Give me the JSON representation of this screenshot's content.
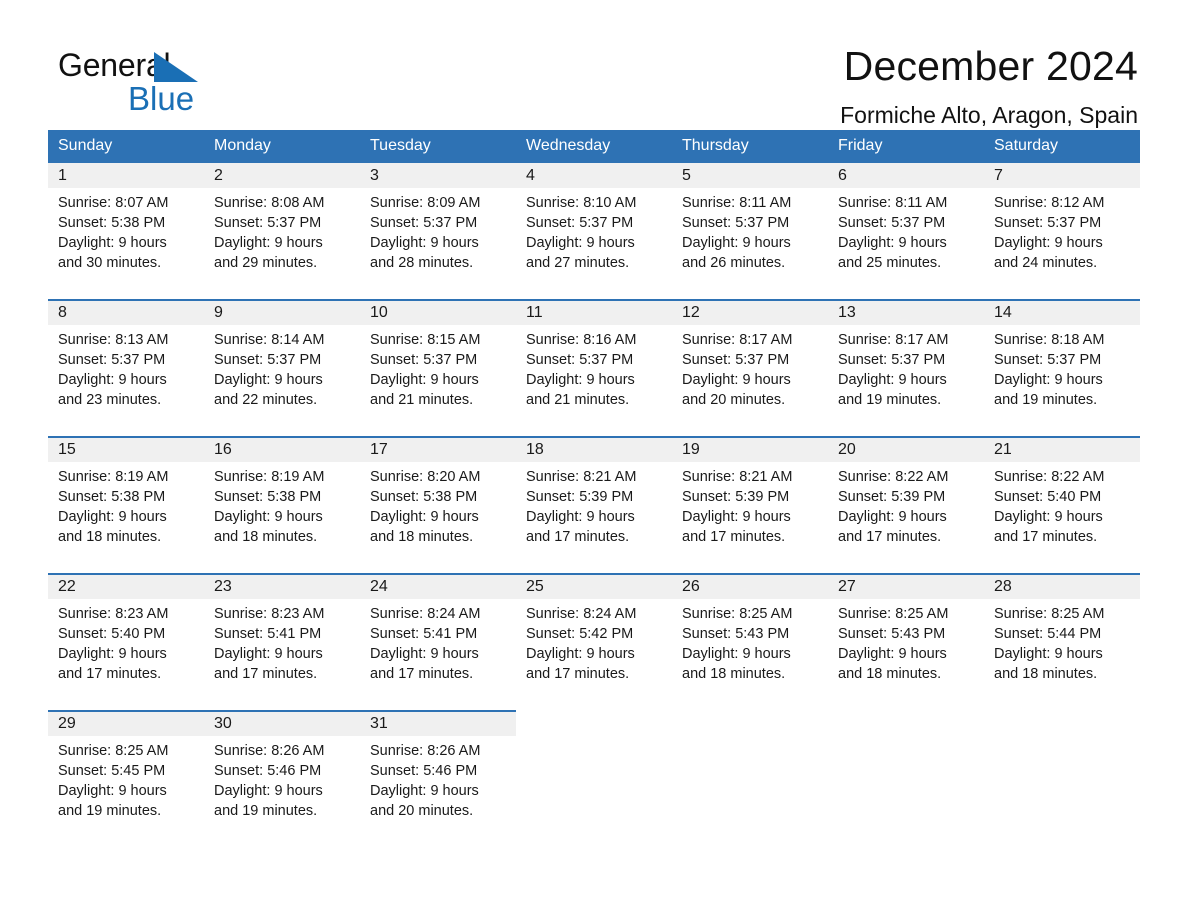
{
  "brand": {
    "name_part1": "General",
    "name_part2": "Blue",
    "triangle_color": "#1a6fb5"
  },
  "header": {
    "title": "December 2024",
    "location": "Formiche Alto, Aragon, Spain"
  },
  "colors": {
    "header_blue": "#2e72b4",
    "daynum_bg": "#f0f0f0",
    "text": "#1a1a1a"
  },
  "calendar": {
    "weekday_headers": [
      "Sunday",
      "Monday",
      "Tuesday",
      "Wednesday",
      "Thursday",
      "Friday",
      "Saturday"
    ],
    "weeks": [
      [
        {
          "day": "1",
          "sunrise": "Sunrise: 8:07 AM",
          "sunset": "Sunset: 5:38 PM",
          "daylight1": "Daylight: 9 hours",
          "daylight2": "and 30 minutes."
        },
        {
          "day": "2",
          "sunrise": "Sunrise: 8:08 AM",
          "sunset": "Sunset: 5:37 PM",
          "daylight1": "Daylight: 9 hours",
          "daylight2": "and 29 minutes."
        },
        {
          "day": "3",
          "sunrise": "Sunrise: 8:09 AM",
          "sunset": "Sunset: 5:37 PM",
          "daylight1": "Daylight: 9 hours",
          "daylight2": "and 28 minutes."
        },
        {
          "day": "4",
          "sunrise": "Sunrise: 8:10 AM",
          "sunset": "Sunset: 5:37 PM",
          "daylight1": "Daylight: 9 hours",
          "daylight2": "and 27 minutes."
        },
        {
          "day": "5",
          "sunrise": "Sunrise: 8:11 AM",
          "sunset": "Sunset: 5:37 PM",
          "daylight1": "Daylight: 9 hours",
          "daylight2": "and 26 minutes."
        },
        {
          "day": "6",
          "sunrise": "Sunrise: 8:11 AM",
          "sunset": "Sunset: 5:37 PM",
          "daylight1": "Daylight: 9 hours",
          "daylight2": "and 25 minutes."
        },
        {
          "day": "7",
          "sunrise": "Sunrise: 8:12 AM",
          "sunset": "Sunset: 5:37 PM",
          "daylight1": "Daylight: 9 hours",
          "daylight2": "and 24 minutes."
        }
      ],
      [
        {
          "day": "8",
          "sunrise": "Sunrise: 8:13 AM",
          "sunset": "Sunset: 5:37 PM",
          "daylight1": "Daylight: 9 hours",
          "daylight2": "and 23 minutes."
        },
        {
          "day": "9",
          "sunrise": "Sunrise: 8:14 AM",
          "sunset": "Sunset: 5:37 PM",
          "daylight1": "Daylight: 9 hours",
          "daylight2": "and 22 minutes."
        },
        {
          "day": "10",
          "sunrise": "Sunrise: 8:15 AM",
          "sunset": "Sunset: 5:37 PM",
          "daylight1": "Daylight: 9 hours",
          "daylight2": "and 21 minutes."
        },
        {
          "day": "11",
          "sunrise": "Sunrise: 8:16 AM",
          "sunset": "Sunset: 5:37 PM",
          "daylight1": "Daylight: 9 hours",
          "daylight2": "and 21 minutes."
        },
        {
          "day": "12",
          "sunrise": "Sunrise: 8:17 AM",
          "sunset": "Sunset: 5:37 PM",
          "daylight1": "Daylight: 9 hours",
          "daylight2": "and 20 minutes."
        },
        {
          "day": "13",
          "sunrise": "Sunrise: 8:17 AM",
          "sunset": "Sunset: 5:37 PM",
          "daylight1": "Daylight: 9 hours",
          "daylight2": "and 19 minutes."
        },
        {
          "day": "14",
          "sunrise": "Sunrise: 8:18 AM",
          "sunset": "Sunset: 5:37 PM",
          "daylight1": "Daylight: 9 hours",
          "daylight2": "and 19 minutes."
        }
      ],
      [
        {
          "day": "15",
          "sunrise": "Sunrise: 8:19 AM",
          "sunset": "Sunset: 5:38 PM",
          "daylight1": "Daylight: 9 hours",
          "daylight2": "and 18 minutes."
        },
        {
          "day": "16",
          "sunrise": "Sunrise: 8:19 AM",
          "sunset": "Sunset: 5:38 PM",
          "daylight1": "Daylight: 9 hours",
          "daylight2": "and 18 minutes."
        },
        {
          "day": "17",
          "sunrise": "Sunrise: 8:20 AM",
          "sunset": "Sunset: 5:38 PM",
          "daylight1": "Daylight: 9 hours",
          "daylight2": "and 18 minutes."
        },
        {
          "day": "18",
          "sunrise": "Sunrise: 8:21 AM",
          "sunset": "Sunset: 5:39 PM",
          "daylight1": "Daylight: 9 hours",
          "daylight2": "and 17 minutes."
        },
        {
          "day": "19",
          "sunrise": "Sunrise: 8:21 AM",
          "sunset": "Sunset: 5:39 PM",
          "daylight1": "Daylight: 9 hours",
          "daylight2": "and 17 minutes."
        },
        {
          "day": "20",
          "sunrise": "Sunrise: 8:22 AM",
          "sunset": "Sunset: 5:39 PM",
          "daylight1": "Daylight: 9 hours",
          "daylight2": "and 17 minutes."
        },
        {
          "day": "21",
          "sunrise": "Sunrise: 8:22 AM",
          "sunset": "Sunset: 5:40 PM",
          "daylight1": "Daylight: 9 hours",
          "daylight2": "and 17 minutes."
        }
      ],
      [
        {
          "day": "22",
          "sunrise": "Sunrise: 8:23 AM",
          "sunset": "Sunset: 5:40 PM",
          "daylight1": "Daylight: 9 hours",
          "daylight2": "and 17 minutes."
        },
        {
          "day": "23",
          "sunrise": "Sunrise: 8:23 AM",
          "sunset": "Sunset: 5:41 PM",
          "daylight1": "Daylight: 9 hours",
          "daylight2": "and 17 minutes."
        },
        {
          "day": "24",
          "sunrise": "Sunrise: 8:24 AM",
          "sunset": "Sunset: 5:41 PM",
          "daylight1": "Daylight: 9 hours",
          "daylight2": "and 17 minutes."
        },
        {
          "day": "25",
          "sunrise": "Sunrise: 8:24 AM",
          "sunset": "Sunset: 5:42 PM",
          "daylight1": "Daylight: 9 hours",
          "daylight2": "and 17 minutes."
        },
        {
          "day": "26",
          "sunrise": "Sunrise: 8:25 AM",
          "sunset": "Sunset: 5:43 PM",
          "daylight1": "Daylight: 9 hours",
          "daylight2": "and 18 minutes."
        },
        {
          "day": "27",
          "sunrise": "Sunrise: 8:25 AM",
          "sunset": "Sunset: 5:43 PM",
          "daylight1": "Daylight: 9 hours",
          "daylight2": "and 18 minutes."
        },
        {
          "day": "28",
          "sunrise": "Sunrise: 8:25 AM",
          "sunset": "Sunset: 5:44 PM",
          "daylight1": "Daylight: 9 hours",
          "daylight2": "and 18 minutes."
        }
      ],
      [
        {
          "day": "29",
          "sunrise": "Sunrise: 8:25 AM",
          "sunset": "Sunset: 5:45 PM",
          "daylight1": "Daylight: 9 hours",
          "daylight2": "and 19 minutes."
        },
        {
          "day": "30",
          "sunrise": "Sunrise: 8:26 AM",
          "sunset": "Sunset: 5:46 PM",
          "daylight1": "Daylight: 9 hours",
          "daylight2": "and 19 minutes."
        },
        {
          "day": "31",
          "sunrise": "Sunrise: 8:26 AM",
          "sunset": "Sunset: 5:46 PM",
          "daylight1": "Daylight: 9 hours",
          "daylight2": "and 20 minutes."
        },
        {
          "day": "",
          "sunrise": "",
          "sunset": "",
          "daylight1": "",
          "daylight2": ""
        },
        {
          "day": "",
          "sunrise": "",
          "sunset": "",
          "daylight1": "",
          "daylight2": ""
        },
        {
          "day": "",
          "sunrise": "",
          "sunset": "",
          "daylight1": "",
          "daylight2": ""
        },
        {
          "day": "",
          "sunrise": "",
          "sunset": "",
          "daylight1": "",
          "daylight2": ""
        }
      ]
    ]
  }
}
